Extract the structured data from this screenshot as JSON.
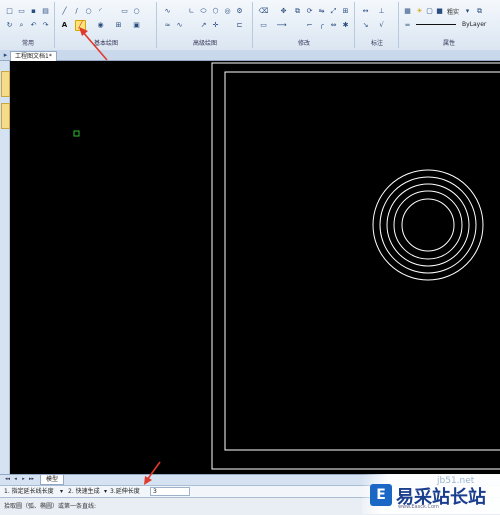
{
  "ribbon": {
    "groups": [
      {
        "label": "常用"
      },
      {
        "label": "基本绘图"
      },
      {
        "label": "高级绘图"
      },
      {
        "label": "修改"
      },
      {
        "label": "标注"
      },
      {
        "label": "属性"
      }
    ],
    "color_label": "粗实",
    "linetype_label": "ByLayer",
    "text_tool": "A"
  },
  "document": {
    "tab_title": "工程图文档1*"
  },
  "model_tab": {
    "label": "模型"
  },
  "command_bar": {
    "options": [
      "1. 指定延长线长度",
      "2. 快速生成",
      "3.延伸长度"
    ],
    "value": "3"
  },
  "status": {
    "prompt": "拾取圆（弧、椭圆）或第一条直线:"
  },
  "watermark": {
    "site": "jb51.net",
    "title": "易采站长站",
    "url": "www.Easck.Com"
  },
  "colors": {
    "canvas": "#000000",
    "drawing_lines": "#ffffff",
    "highlight": "#ffe27a",
    "annotation": "#e03a2e",
    "marker": "#2fbf2f"
  },
  "icons": {
    "new": "new-file-icon",
    "open": "open-folder-icon",
    "save": "save-icon",
    "line": "line-icon",
    "circle": "circle-icon",
    "text": "text-icon",
    "centerline": "centerline-icon",
    "dimension": "dimension-icon"
  }
}
